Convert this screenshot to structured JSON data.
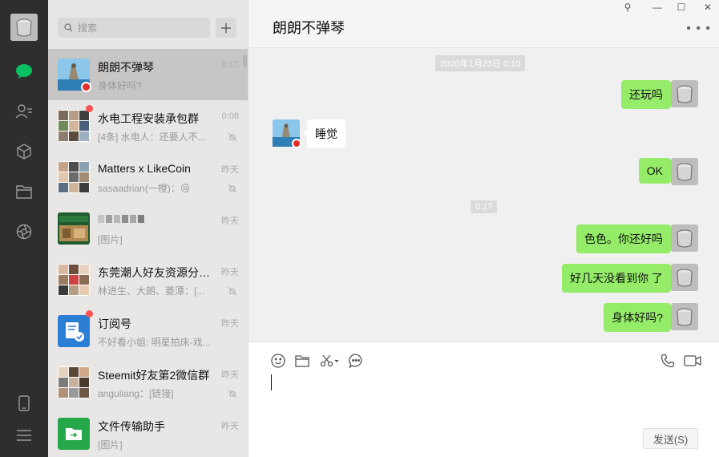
{
  "window": {
    "controls": [
      "—",
      "☐",
      "✕"
    ],
    "pin_label": "⚲"
  },
  "search": {
    "placeholder": "搜索"
  },
  "chats": [
    {
      "name": "朗朗不弹琴",
      "preview": "身体好吗?",
      "time": "0:17",
      "active": true
    },
    {
      "name": "水电工程安装承包群",
      "preview": "[4条] 水电人：还要人不...",
      "time": "0:08",
      "unread": true,
      "muted": true
    },
    {
      "name": "Matters x LikeCoin",
      "preview": "sasaadrian(一橙)：😢",
      "time": "昨天",
      "muted": true
    },
    {
      "name": "",
      "preview": "[图片]",
      "time": "昨天"
    },
    {
      "name": "东莞潮人好友资源分享...",
      "preview": "林进生、大朗、菱潭：[...",
      "time": "昨天",
      "muted": true
    },
    {
      "name": "订阅号",
      "preview": "不好看小姐: 明星拍床-戏...",
      "time": "昨天",
      "unread": true
    },
    {
      "name": "Steemit好友第2微信群",
      "preview": "anguliang：[链接]",
      "time": "昨天",
      "muted": true
    },
    {
      "name": "文件传输助手",
      "preview": "[图片]",
      "time": "昨天"
    }
  ],
  "conversation": {
    "title": "朗朗不弹琴",
    "timestamps": [
      "2020年1月23日 0:10",
      "0:17"
    ],
    "messages": [
      {
        "from": "me",
        "text": "还玩吗"
      },
      {
        "from": "other",
        "text": "睡觉"
      },
      {
        "from": "me",
        "text": "OK"
      },
      {
        "from": "me",
        "text": "色色。你还好吗"
      },
      {
        "from": "me",
        "text": "好几天没看到你 了"
      },
      {
        "from": "me",
        "text": "身体好吗?"
      }
    ]
  },
  "input": {
    "send_label": "发送(S)"
  },
  "colors": {
    "sent_bubble": "#95ec69",
    "sidebar": "#2e2e2e",
    "accent": "#07c160"
  }
}
